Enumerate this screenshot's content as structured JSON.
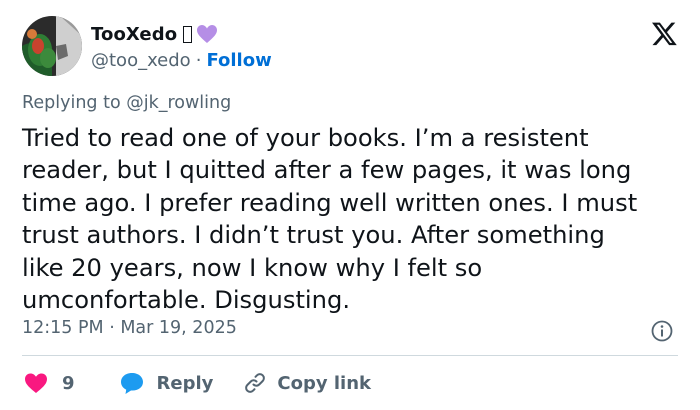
{
  "author": {
    "display_name": "TooXedo",
    "name_glyphs": [
      "missing-glyph-box",
      "purple-heart-emoji"
    ],
    "handle": "@too_xedo",
    "separator": "·",
    "follow_label": "Follow"
  },
  "brand_icon": "x-logo-icon",
  "replying_to": "Replying to @jk_rowling",
  "tweet": {
    "text": "Tried to read one of your books. I’m a resistent\nreader, but I quitted after a few pages, it was long\ntime ago. I prefer reading well written ones. I must\ntrust authors. I didn’t trust you. After something\nlike 20 years, now I know why I felt so\numconfortable. Disgusting."
  },
  "timestamp": "12:15 PM · Mar 19, 2025",
  "actions": {
    "like_count": "9",
    "reply_label": "Reply",
    "copy_link_label": "Copy link"
  },
  "colors": {
    "text": "#0f1419",
    "muted": "#536471",
    "link": "#006fd6",
    "like": "#f91880",
    "reply": "#1d9bf0",
    "heart_emoji": "#b58ee6",
    "divider": "#cfd9de"
  }
}
